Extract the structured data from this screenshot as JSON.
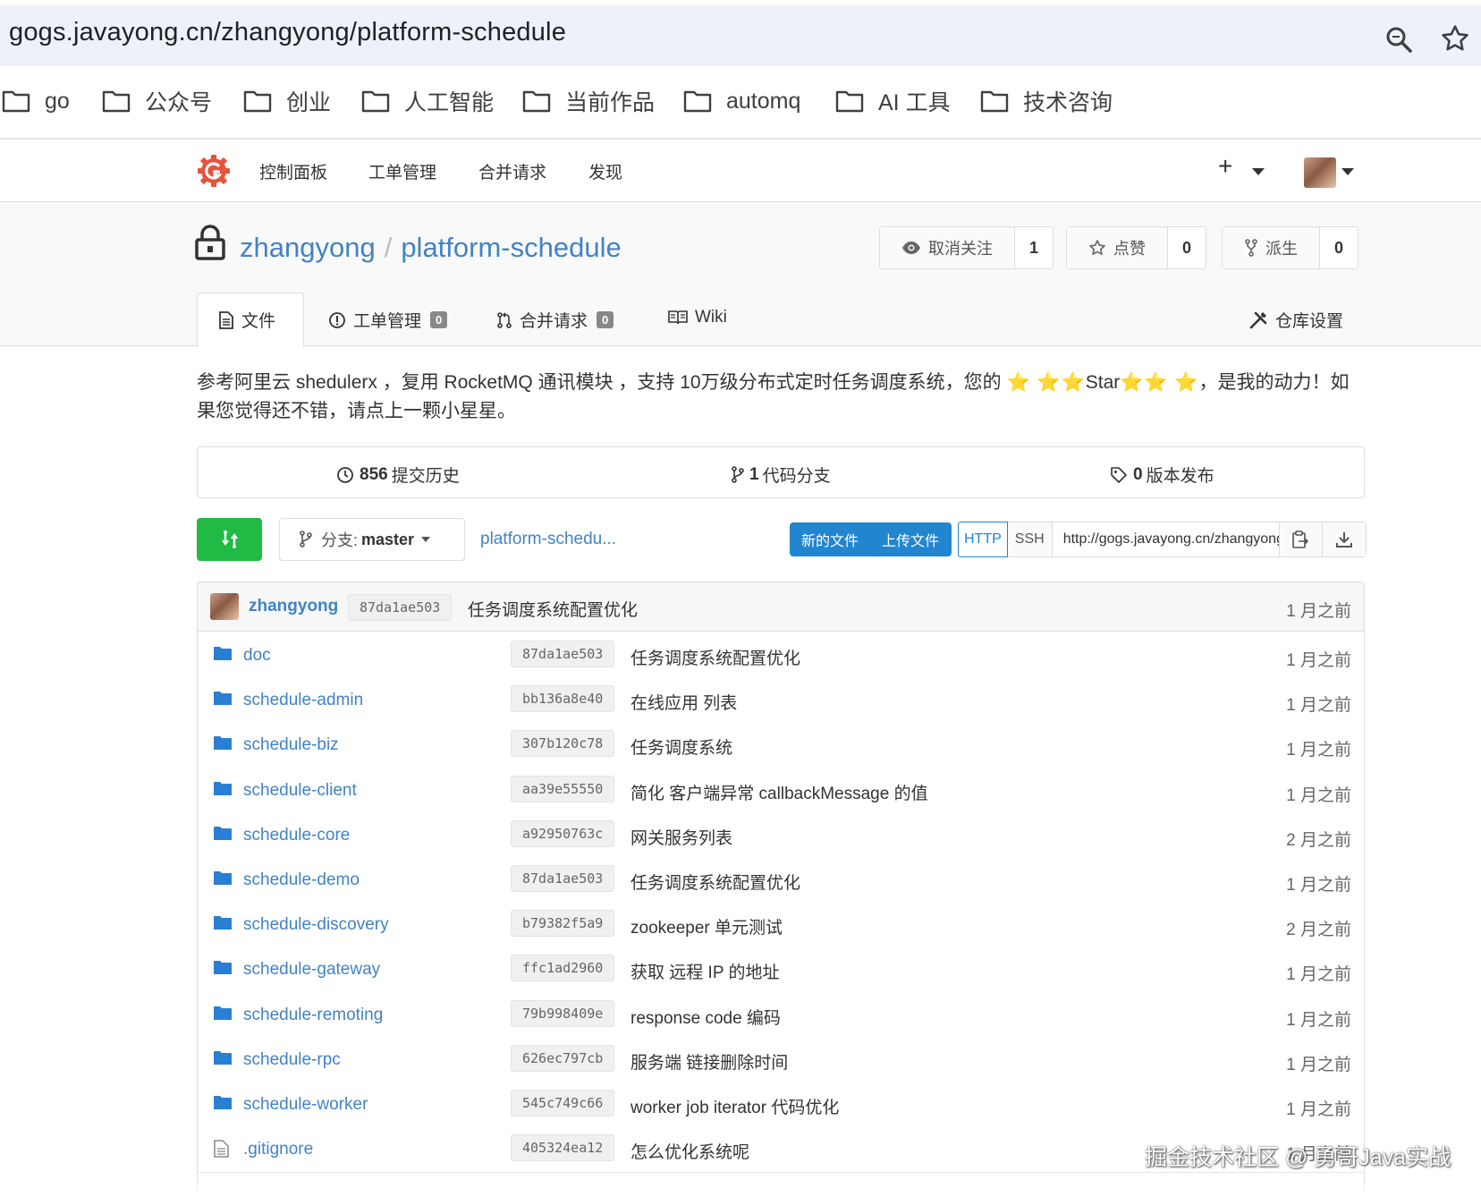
{
  "browser": {
    "url": "gogs.javayong.cn/zhangyong/platform-schedule",
    "bookmarks": [
      "go",
      "公众号",
      "创业",
      "人工智能",
      "当前作品",
      "automq",
      "AI 工具",
      "技术咨询"
    ]
  },
  "nav": {
    "items": [
      "控制面板",
      "工单管理",
      "合并请求",
      "发现"
    ],
    "plus": "+"
  },
  "repo": {
    "owner": "zhangyong",
    "separator": "/",
    "name": "platform-schedule",
    "watch": {
      "label": "取消关注",
      "count": "1"
    },
    "star": {
      "label": "点赞",
      "count": "0"
    },
    "fork": {
      "label": "派生",
      "count": "0"
    }
  },
  "tabs": {
    "files": "文件",
    "issues": "工单管理",
    "issues_count": "0",
    "pulls": "合并请求",
    "pulls_count": "0",
    "wiki": "Wiki",
    "settings": "仓库设置"
  },
  "description": {
    "part1": "参考阿里云 shedulerx ，复用 RocketMQ 通讯模块 ，支持 10万级分布式定时任务调度系统，您的 ",
    "stars_left": "⭐ ⭐⭐",
    "star_word": "Star",
    "stars_right": "⭐⭐ ⭐",
    "part2": "，是我的动力！如果您觉得还不错，请点上一颗小星星。"
  },
  "stats": {
    "commits_count": "856",
    "commits_label": "提交历史",
    "branches_count": "1",
    "branches_label": "代码分支",
    "releases_count": "0",
    "releases_label": "版本发布"
  },
  "toolbar": {
    "branch_prefix": "分支:",
    "branch_name": "master",
    "breadcrumb": "platform-schedu...",
    "new_file": "新的文件",
    "upload_file": "上传文件",
    "http": "HTTP",
    "ssh": "SSH",
    "clone_url": "http://gogs.javayong.cn/zhangyong/platform-schedule.git"
  },
  "latest_commit": {
    "author": "zhangyong",
    "sha": "87da1ae503",
    "message": "任务调度系统配置优化",
    "age": "1 月之前"
  },
  "files": [
    {
      "name": "doc",
      "type": "dir",
      "sha": "87da1ae503",
      "message": "任务调度系统配置优化",
      "age": "1 月之前"
    },
    {
      "name": "schedule-admin",
      "type": "dir",
      "sha": "bb136a8e40",
      "message": "在线应用 列表",
      "age": "1 月之前"
    },
    {
      "name": "schedule-biz",
      "type": "dir",
      "sha": "307b120c78",
      "message": "任务调度系统",
      "age": "1 月之前"
    },
    {
      "name": "schedule-client",
      "type": "dir",
      "sha": "aa39e55550",
      "message": "简化 客户端异常 callbackMessage 的值",
      "age": "1 月之前"
    },
    {
      "name": "schedule-core",
      "type": "dir",
      "sha": "a92950763c",
      "message": "网关服务列表",
      "age": "2 月之前"
    },
    {
      "name": "schedule-demo",
      "type": "dir",
      "sha": "87da1ae503",
      "message": "任务调度系统配置优化",
      "age": "1 月之前"
    },
    {
      "name": "schedule-discovery",
      "type": "dir",
      "sha": "b79382f5a9",
      "message": "zookeeper 单元测试",
      "age": "2 月之前"
    },
    {
      "name": "schedule-gateway",
      "type": "dir",
      "sha": "ffc1ad2960",
      "message": "获取 远程 IP 的地址",
      "age": "1 月之前"
    },
    {
      "name": "schedule-remoting",
      "type": "dir",
      "sha": "79b998409e",
      "message": "response code 编码",
      "age": "1 月之前"
    },
    {
      "name": "schedule-rpc",
      "type": "dir",
      "sha": "626ec797cb",
      "message": "服务端 链接删除时间",
      "age": "1 月之前"
    },
    {
      "name": "schedule-worker",
      "type": "dir",
      "sha": "545c749c66",
      "message": "worker job iterator 代码优化",
      "age": "1 月之前"
    },
    {
      "name": ".gitignore",
      "type": "file",
      "sha": "405324ea12",
      "message": "怎么优化系统呢",
      "age": "1 月之前"
    }
  ],
  "watermark": "掘金技术社区 @ 勇哥Java实战",
  "colors": {
    "link": "#4183c4",
    "green": "#21ba45",
    "blue": "#2185d0",
    "folder": "#2a7fd4"
  }
}
